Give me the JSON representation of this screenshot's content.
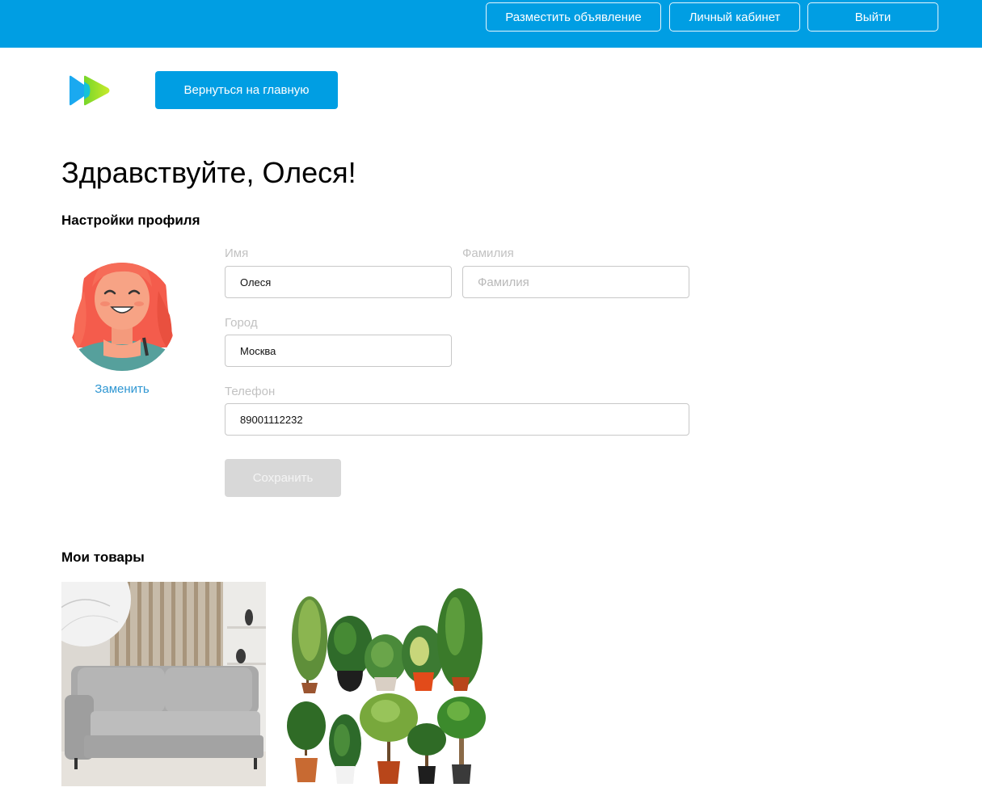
{
  "header": {
    "buttons": [
      {
        "label": "Разместить объявление"
      },
      {
        "label": "Личный кабинет"
      },
      {
        "label": "Выйти"
      }
    ],
    "color": "#009ee3"
  },
  "nav": {
    "logo_icon": "play-logo-icon",
    "back_label": "Вернуться на главную"
  },
  "greeting": "Здравствуйте, Олеся!",
  "profile": {
    "title": "Настройки профиля",
    "avatar_icon": "woman-avatar-icon",
    "change_label": "Заменить",
    "fields": {
      "first_name": {
        "label": "Имя",
        "value": "Олеся",
        "placeholder": ""
      },
      "last_name": {
        "label": "Фамилия",
        "value": "",
        "placeholder": "Фамилия"
      },
      "city": {
        "label": "Город",
        "value": "Москва",
        "placeholder": ""
      },
      "phone": {
        "label": "Телефон",
        "value": "89001112232",
        "placeholder": ""
      }
    },
    "save_label": "Сохранить"
  },
  "products": {
    "title": "Мои товары",
    "items": [
      {
        "image": "gray-sofa-image"
      },
      {
        "image": "potted-plants-image"
      }
    ]
  },
  "colors": {
    "accent": "#009ee3",
    "link": "#2e96d2",
    "disabled_button": "#d8d8d8"
  }
}
